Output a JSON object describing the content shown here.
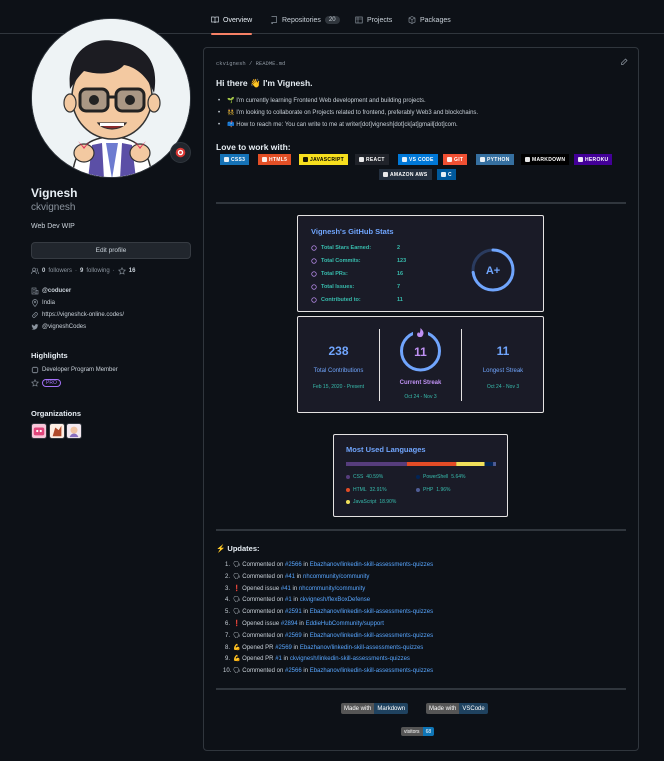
{
  "tabs": [
    {
      "label": "Overview"
    },
    {
      "label": "Repositories",
      "count": "20"
    },
    {
      "label": "Projects"
    },
    {
      "label": "Packages"
    }
  ],
  "profile": {
    "full_name": "Vignesh",
    "login": "ckvignesh",
    "bio": "Web Dev WIP",
    "edit_label": "Edit profile",
    "followers_count": "0",
    "followers_label": "followers",
    "following_count": "9",
    "following_label": "following",
    "stars_count": "16",
    "company": "@coducer",
    "location": "India",
    "website": "https://vigneshck-online.codes/",
    "twitter": "@vigneshCodes"
  },
  "highlights": {
    "title": "Highlights",
    "program": "Developer Program Member",
    "pro": "PRO"
  },
  "organizations": {
    "title": "Organizations"
  },
  "readme": {
    "path_user": "ckvignesh",
    "path_sep": " / ",
    "path_file": "README.md",
    "greeting": "Hi there 👋 I'm Vignesh.",
    "bullets": [
      "🌱 I'm currently learning Frontend Web development and building projects.",
      "👯 I'm looking to collaborate on Projects related to frontend, preferably Web3 and blockchains.",
      "📫 How to reach me: You can write to me at writer[dot]vignesh[dot]ck[at]gmail[dot]com."
    ],
    "love_title": "Love to work with:",
    "badges": [
      {
        "label": "CSS3",
        "color": "#1572b6"
      },
      {
        "label": "HTML5",
        "color": "#e34f26"
      },
      {
        "label": "JAVASCRIPT",
        "color": "#f7df1e",
        "text": "#000000"
      },
      {
        "label": "REACT",
        "color": "#20232a"
      },
      {
        "label": "VS CODE",
        "color": "#0078d7"
      },
      {
        "label": "GIT",
        "color": "#f05033"
      },
      {
        "label": "PYTHON",
        "color": "#3670a0"
      },
      {
        "label": "MARKDOWN",
        "color": "#000000"
      },
      {
        "label": "HEROKU",
        "color": "#430098"
      },
      {
        "label": "AMAZON AWS",
        "color": "#232f3e"
      },
      {
        "label": "C",
        "color": "#00599c"
      }
    ]
  },
  "stats": {
    "title": "Vignesh's GitHub Stats",
    "rows": [
      {
        "label": "Total Stars Earned:",
        "value": "2"
      },
      {
        "label": "Total Commits:",
        "value": "123"
      },
      {
        "label": "Total PRs:",
        "value": "16"
      },
      {
        "label": "Total Issues:",
        "value": "7"
      },
      {
        "label": "Contributed to:",
        "value": "11"
      }
    ],
    "grade": "A+",
    "grade_progress": 0.73
  },
  "streak": {
    "total": "238",
    "total_label": "Total Contributions",
    "total_range": "Feb 15, 2020 - Present",
    "current": "11",
    "current_label": "Current Streak",
    "current_range": "Oct 24 - Nov 3",
    "longest": "11",
    "longest_label": "Longest Streak",
    "longest_range": "Oct 24 - Nov 3"
  },
  "languages": {
    "title": "Most Used Languages",
    "items": [
      {
        "name": "CSS",
        "pct": "40.59%",
        "value": 40.59,
        "color": "#563d7c"
      },
      {
        "name": "HTML",
        "pct": "32.91%",
        "value": 32.91,
        "color": "#e34c26"
      },
      {
        "name": "JavaScript",
        "pct": "18.90%",
        "value": 18.9,
        "color": "#f1e05a"
      },
      {
        "name": "PowerShell",
        "pct": "5.64%",
        "value": 5.64,
        "color": "#012456"
      },
      {
        "name": "PHP",
        "pct": "1.96%",
        "value": 1.96,
        "color": "#4f5d95"
      }
    ]
  },
  "updates": {
    "title": "⚡ Updates:",
    "items": [
      {
        "emoji": "🗣",
        "pre": "Commented on",
        "ref": "#2566",
        "mid": "in",
        "repo": "Ebazhanov/linkedin-skill-assessments-quizzes"
      },
      {
        "emoji": "🗣",
        "pre": "Commented on",
        "ref": "#41",
        "mid": "in",
        "repo": "nhcommunity/community"
      },
      {
        "emoji": "❗",
        "pre": "Opened issue",
        "ref": "#41",
        "mid": "in",
        "repo": "nhcommunity/community"
      },
      {
        "emoji": "🗣",
        "pre": "Commented on",
        "ref": "#1",
        "mid": "in",
        "repo": "ckvignesh/flexBoxDefense"
      },
      {
        "emoji": "🗣",
        "pre": "Commented on",
        "ref": "#2591",
        "mid": "in",
        "repo": "Ebazhanov/linkedin-skill-assessments-quizzes"
      },
      {
        "emoji": "❗",
        "pre": "Opened issue",
        "ref": "#2894",
        "mid": "in",
        "repo": "EddieHubCommunity/support"
      },
      {
        "emoji": "🗣",
        "pre": "Commented on",
        "ref": "#2569",
        "mid": "in",
        "repo": "Ebazhanov/linkedin-skill-assessments-quizzes"
      },
      {
        "emoji": "💪",
        "pre": "Opened PR",
        "ref": "#2569",
        "mid": "in",
        "repo": "Ebazhanov/linkedin-skill-assessments-quizzes"
      },
      {
        "emoji": "💪",
        "pre": "Opened PR",
        "ref": "#1",
        "mid": "in",
        "repo": "ckvignesh/linkedin-skill-assessments-quizzes"
      },
      {
        "emoji": "🗣",
        "pre": "Commented on",
        "ref": "#2566",
        "mid": "in",
        "repo": "Ebazhanov/linkedin-skill-assessments-quizzes"
      }
    ]
  },
  "footer": {
    "made1_l": "Made with",
    "made1_r": "Markdown",
    "made2_l": "Made with",
    "made2_r": "VSCode",
    "visitors_l": "visitors",
    "visitors_r": "68"
  }
}
